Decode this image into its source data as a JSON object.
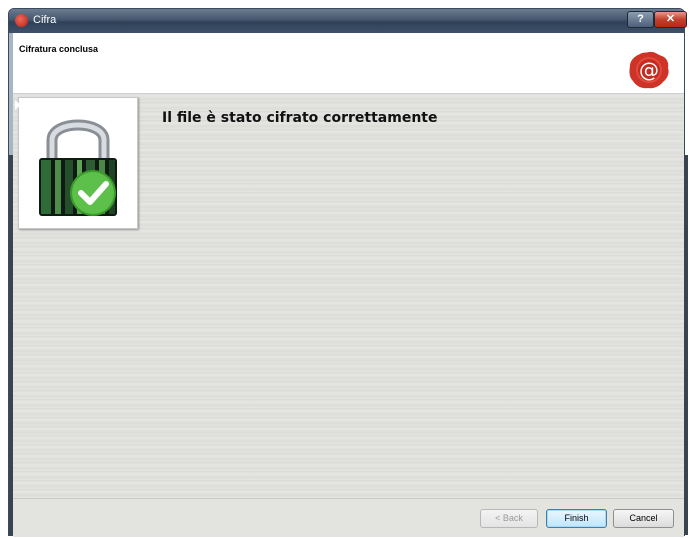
{
  "window": {
    "title": "Cifra",
    "help_label": "?",
    "close_label": "✕"
  },
  "header": {
    "title": "Cifratura conclusa"
  },
  "content": {
    "message": "Il file è stato cifrato correttamente"
  },
  "buttons": {
    "back": "< Back",
    "finish": "Finish",
    "cancel": "Cancel"
  },
  "colors": {
    "seal": "#d4342a",
    "checkmark": "#4fb83a"
  },
  "icons": {
    "app": "cifra-app-icon",
    "header": "wax-seal-at-icon",
    "content": "padlock-check-icon"
  }
}
